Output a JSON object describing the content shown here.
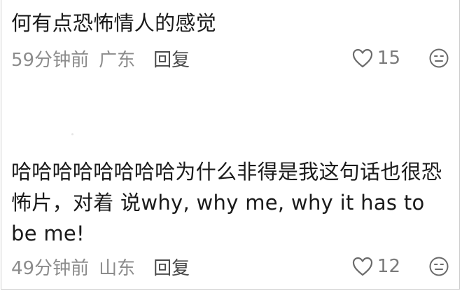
{
  "comments": [
    {
      "text": "何有点恐怖情人的感觉",
      "time": "59分钟前",
      "location": "广东",
      "reply_label": "回复",
      "likes": "15"
    },
    {
      "text": "哈哈哈哈哈哈哈哈为什么非得是我这句话也很恐怖片，对着 说why, why me, why it has to be me!",
      "time": "49分钟前",
      "location": "山东",
      "reply_label": "回复",
      "likes": "12"
    }
  ],
  "icons": {
    "like": "heart-outline-icon",
    "emoji": "emoji-face-icon"
  },
  "colors": {
    "text": "#1a1a1a",
    "meta": "#8c8c8c",
    "icon": "#6a6a6a",
    "background": "#ffffff"
  }
}
